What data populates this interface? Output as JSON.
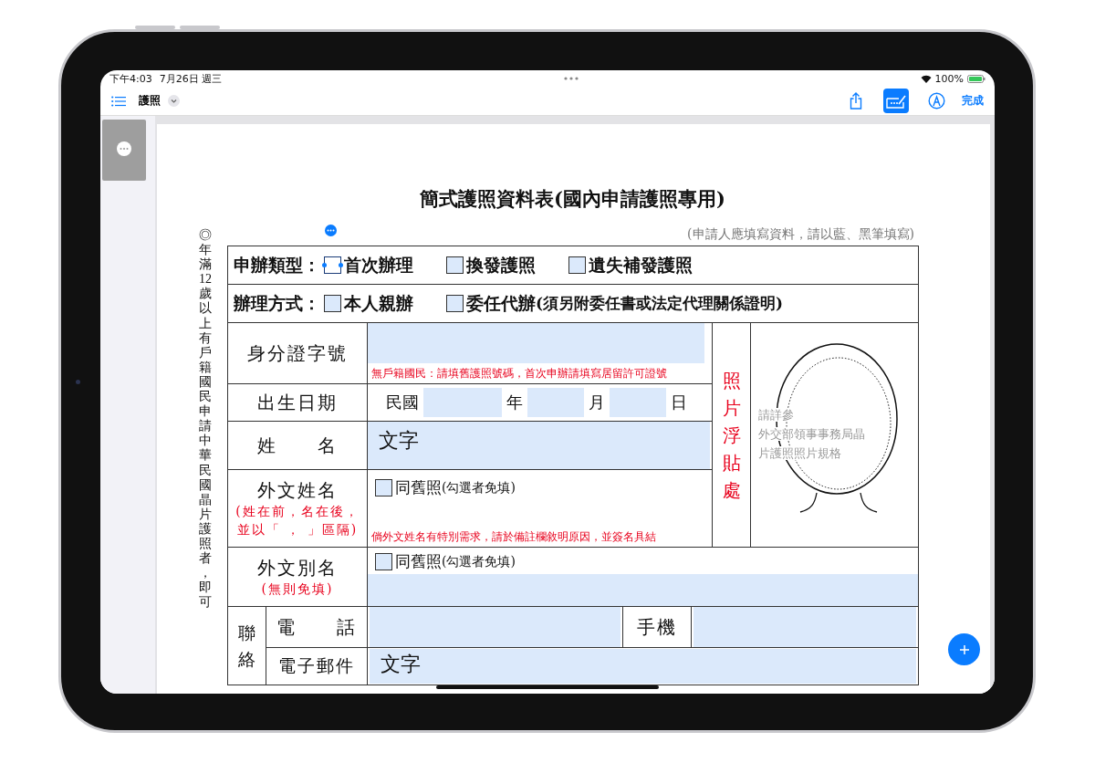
{
  "status_bar": {
    "time": "下午4:03",
    "date": "7月26日 週三",
    "battery": "100%"
  },
  "toolbar": {
    "title": "護照",
    "done": "完成",
    "tools": [
      {
        "kind": "share",
        "selected": false
      },
      {
        "kind": "form",
        "selected": true
      },
      {
        "kind": "markup",
        "selected": false
      }
    ]
  },
  "document": {
    "title": "簡式護照資料表(國內申請護照專用)",
    "note": "(申請人應填寫資料，請以藍、黑筆填寫)",
    "side_note": "◎年滿12歲以上有戶籍國民申請中華民國晶片護照者，即可",
    "type_row": {
      "label": "申辦類型：",
      "options": [
        {
          "label": "首次辦理",
          "checked": false,
          "selected": true
        },
        {
          "label": "換發護照",
          "checked": false,
          "selected": false
        },
        {
          "label": "遺失補發護照",
          "checked": false,
          "selected": false
        }
      ]
    },
    "method_row": {
      "label": "辦理方式：",
      "options": [
        {
          "label": "本人親辦",
          "checked": false,
          "selected": false
        },
        {
          "label": "委任代辦",
          "note": "(須另附委任書或法定代理關係證明)",
          "checked": false,
          "selected": false
        }
      ]
    },
    "id_row": {
      "label": "身分證字號",
      "hint": "無戶籍國民：請填舊護照號碼，首次申辦請填寫居留許可證號"
    },
    "birth_row": {
      "label": "出生日期",
      "era": "民國",
      "year": "年",
      "month": "月",
      "day": "日"
    },
    "name_row": {
      "label": "姓　　名",
      "value": "文字"
    },
    "foreign_name_row": {
      "label": "外文姓名",
      "sublabel": [
        "(姓在前，名在後，",
        "並以「 ， 」區隔)"
      ],
      "option": {
        "label": "同舊照",
        "note": "(勾選者免填)",
        "checked": false
      },
      "hint": "倘外文姓名有特別需求，請於備註欄敘明原因，並簽名具結"
    },
    "photo": {
      "label": "照片浮貼處",
      "note": [
        "請詳參",
        "外交部領事事務局晶",
        "片護照照片規格"
      ]
    },
    "alias_row": {
      "label": "外文別名",
      "sublabel": "(無則免填)",
      "option": {
        "label": "同舊照",
        "note": "(勾選者免填)",
        "checked": false
      }
    },
    "contact": {
      "label": "聯絡",
      "phone_label": "電　　話",
      "mobile_label": "手機",
      "email_label": "電子郵件",
      "email_value": "文字"
    }
  }
}
